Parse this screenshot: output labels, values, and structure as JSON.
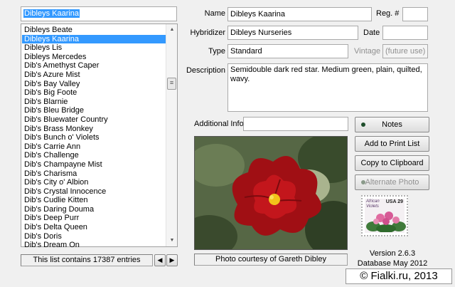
{
  "search": {
    "value": "Dibleys Kaarina"
  },
  "list": {
    "items": [
      "Dibleys Beate",
      "Dibleys Kaarina",
      "Dibleys Lis",
      "Dibleys Mercedes",
      "Dib's Amethyst Caper",
      "Dib's Azure Mist",
      "Dib's Bay Valley",
      "Dib's Big Foote",
      "Dib's Blarnie",
      "Dib's Bleu Bridge",
      "Dib's Bluewater Country",
      "Dib's Brass Monkey",
      "Dib's Bunch o' Violets",
      "Dib's Carrie Ann",
      "Dib's Challenge",
      "Dib's Champayne Mist",
      "Dib's Charisma",
      "Dib's City o' Albion",
      "Dib's Crystal Innocence",
      "Dib's Cudlie Kitten",
      "Dib's Daring Douma",
      "Dib's Deep Purr",
      "Dib's Delta Queen",
      "Dib's Doris",
      "Dib's Dream On"
    ],
    "selected_index": 1,
    "count_text": "This list contains 17387 entries"
  },
  "fields": {
    "name_label": "Name",
    "name_value": "Dibleys Kaarina",
    "reg_label": "Reg. #",
    "reg_value": "",
    "hybridizer_label": "Hybridizer",
    "hybridizer_value": "Dibleys Nurseries",
    "date_label": "Date",
    "date_value": "",
    "type_label": "Type",
    "type_value": "Standard",
    "vintage_label": "Vintage",
    "vintage_value": "(future use)",
    "description_label": "Description",
    "description_value": "Semidouble dark red star. Medium green, plain, quilted, wavy.",
    "additional_label": "Additional Info",
    "additional_value": ""
  },
  "buttons": {
    "notes": "Notes",
    "add_print": "Add to Print List",
    "copy_clipboard": "Copy to Clipboard",
    "alternate_photo": "Alternate Photo"
  },
  "photo": {
    "caption": "Photo courtesy of Gareth Dibley"
  },
  "stamp": {
    "line1": "African",
    "line2": "Violets",
    "value": "USA 29"
  },
  "version": {
    "line1": "Version 2.6.3",
    "line2": "Database May 2012"
  },
  "watermark": "© Fialki.ru, 2013",
  "colors": {
    "selection": "#3399ff",
    "notes_led": "#1e4d2b",
    "alt_led": "#8a9a8a"
  }
}
